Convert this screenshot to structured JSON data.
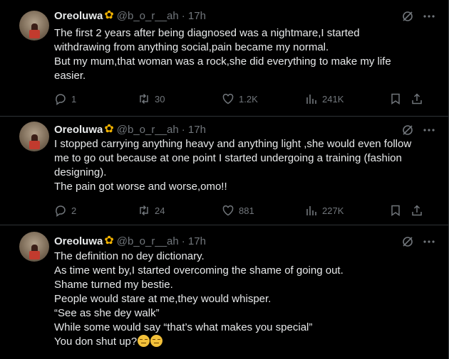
{
  "tweets": [
    {
      "author": "Oreoluwa",
      "handle": "@b_o_r__ah",
      "time": "· 17h",
      "lines": [
        "The first 2 years after being diagnosed was a nightmare,I started",
        "withdrawing from anything social,pain became my normal.",
        "But my mum,that woman was a rock,she did everything to make my life",
        "easier."
      ],
      "replies": "1",
      "reposts": "30",
      "likes": "1.2K",
      "views": "241K"
    },
    {
      "author": "Oreoluwa",
      "handle": "@b_o_r__ah",
      "time": "· 17h",
      "lines": [
        "I stopped carrying anything heavy and anything light ,she would even follow",
        "me to go out because at one point I started undergoing a training (fashion",
        "designing).",
        "The pain got worse and worse,omo!!"
      ],
      "replies": "2",
      "reposts": "24",
      "likes": "881",
      "views": "227K"
    },
    {
      "author": "Oreoluwa",
      "handle": "@b_o_r__ah",
      "time": "· 17h",
      "lines": [
        "The definition no dey dictionary.",
        "As time went by,I started overcoming the shame of going out.",
        "Shame turned my bestie.",
        "People would stare at me,they would whisper.",
        "“See as she dey walk”",
        "While some would say “that’s what makes you special”",
        "You don shut up?"
      ]
    }
  ],
  "icons": {
    "badge": "sunflower-badge-icon",
    "grok": "grok-icon",
    "more": "more-icon",
    "reply": "reply-icon",
    "repost": "repost-icon",
    "like": "heart-icon",
    "views": "views-icon",
    "bookmark": "bookmark-icon",
    "share": "share-icon",
    "emoji": "unamused-face-emoji"
  },
  "colors": {
    "background": "#000000",
    "text": "#e7e9ea",
    "muted": "#71767b",
    "divider": "#2f3336",
    "badge": "#f4b400"
  }
}
